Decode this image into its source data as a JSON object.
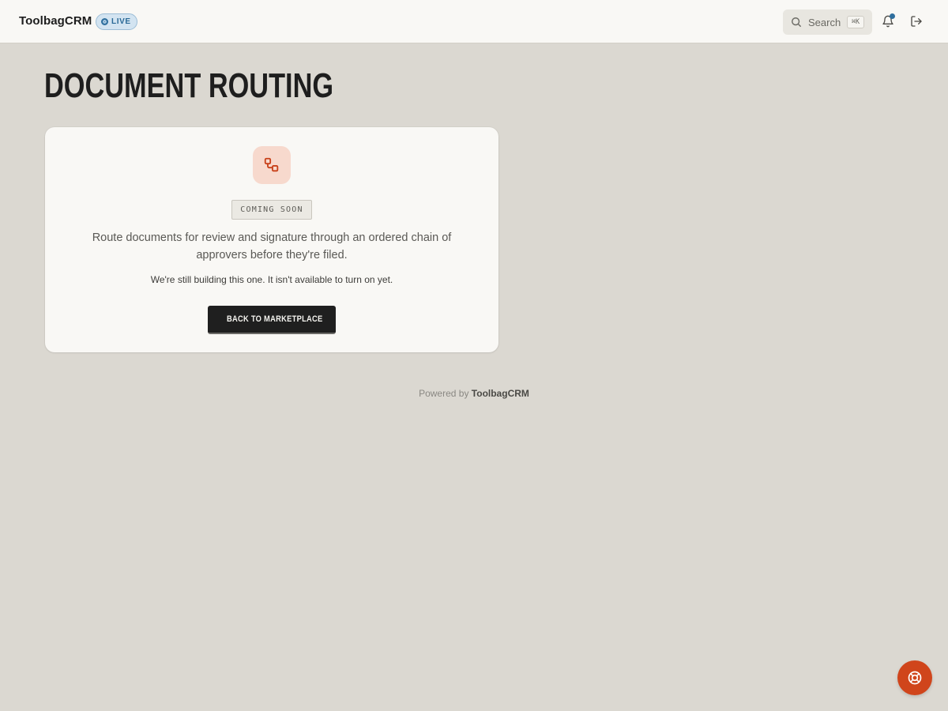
{
  "header": {
    "brand": "ToolbagCRM",
    "status_badge": "LIVE",
    "search": {
      "label": "Search",
      "shortcut": "⌘K"
    },
    "icons": [
      "search-icon",
      "bell-icon",
      "logout-icon"
    ]
  },
  "page": {
    "title": "DOCUMENT ROUTING"
  },
  "card": {
    "icon": "workflow-icon",
    "badge": "COMING SOON",
    "description": "Route documents for review and signature through an ordered chain of approvers before they're filed.",
    "note": "We're still building this one. It isn't available to turn on yet.",
    "back_button": "BACK TO MARKETPLACE"
  },
  "footer": {
    "prefix": "Powered by",
    "brand": "ToolbagCRM"
  },
  "help_button": {
    "icon": "lifebuoy-icon"
  },
  "colors": {
    "background": "#dbd8d1",
    "surface": "#f9f8f5",
    "accent": "#d0451b",
    "live_blue": "#2f6f9e",
    "button_dark": "#1f1f1f"
  }
}
